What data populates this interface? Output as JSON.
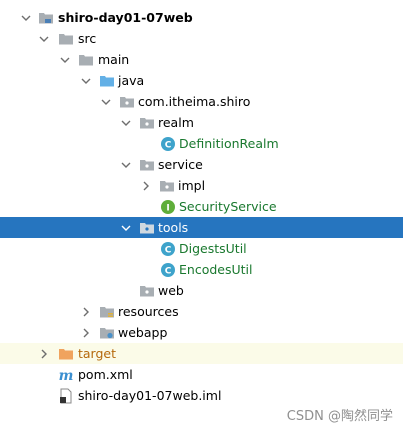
{
  "tree": {
    "root": "shiro-day01-07web",
    "src": "src",
    "main": "main",
    "java": "java",
    "package": "com.itheima.shiro",
    "realm": "realm",
    "definition_realm": "DefinitionRealm",
    "service": "service",
    "impl": "impl",
    "security_service": "SecurityService",
    "tools": "tools",
    "digests_util": "DigestsUtil",
    "encodes_util": "EncodesUtil",
    "web": "web",
    "resources": "resources",
    "webapp": "webapp",
    "target": "target",
    "pom": "pom.xml",
    "iml": "shiro-day01-07web.iml"
  },
  "watermark": "CSDN @陶然同学",
  "colors": {
    "selection": "#2675bf",
    "excluded_row": "#fbfbe8",
    "java_class_text": "#19782e",
    "class_icon": "#3ea3cb",
    "interface_icon": "#5fae3a",
    "folder": "#a8aeb3",
    "source_folder": "#63b0e6",
    "target_folder": "#f0a35e"
  }
}
